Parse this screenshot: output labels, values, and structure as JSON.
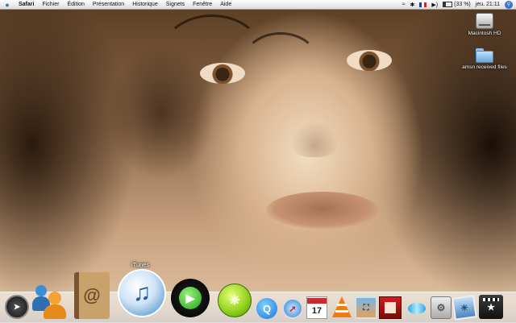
{
  "menubar": {
    "apple_icon": "apple-icon",
    "items": [
      "Safari",
      "Fichier",
      "Édition",
      "Présentation",
      "Historique",
      "Signets",
      "Fenêtre",
      "Aide"
    ],
    "tray": {
      "wifi_icon": "wifi-icon",
      "bluetooth_icon": "bluetooth-icon",
      "flag_icon": "french-flag-icon",
      "volume_icon": "volume-icon",
      "battery_text": "(33 %)",
      "clock": "jeu. 21:11",
      "spotlight_icon": "spotlight-icon"
    }
  },
  "desktop": {
    "icons": [
      {
        "label": "Macintosh HD",
        "icon": "hard-drive-icon"
      },
      {
        "label": "amsn received files",
        "icon": "folder-icon"
      }
    ]
  },
  "dock": {
    "tooltip": "iTunes",
    "items": [
      {
        "name": "Dashboard",
        "icon": "dashboard-icon"
      },
      {
        "name": "MSN Messenger",
        "icon": "msn-buddies-icon"
      },
      {
        "name": "Address Book",
        "icon": "address-book-icon"
      },
      {
        "name": "iTunes",
        "icon": "itunes-icon"
      },
      {
        "name": "Media Player",
        "icon": "media-player-icon"
      },
      {
        "name": "LimeWire",
        "icon": "limewire-icon"
      },
      {
        "name": "QuickTime",
        "icon": "quicktime-icon"
      },
      {
        "name": "Safari",
        "icon": "safari-icon"
      },
      {
        "name": "iCal",
        "icon": "ical-icon"
      },
      {
        "name": "VLC",
        "icon": "vlc-icon"
      },
      {
        "name": "Preview",
        "icon": "preview-icon"
      },
      {
        "name": "Photo Booth",
        "icon": "photo-booth-icon"
      },
      {
        "name": "Fish",
        "icon": "fish-icon"
      },
      {
        "name": "System Preferences",
        "icon": "system-preferences-icon"
      },
      {
        "name": "iPhoto",
        "icon": "iphoto-icon"
      },
      {
        "name": "iMovie",
        "icon": "imovie-icon"
      }
    ],
    "ical_date": "17"
  }
}
